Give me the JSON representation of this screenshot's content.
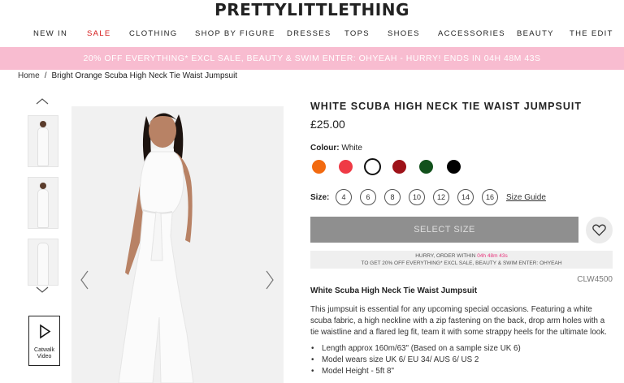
{
  "header": {
    "logo": "PRETTYLITTLETHING"
  },
  "nav": [
    "NEW IN",
    "SALE",
    "CLOTHING",
    "SHOP BY FIGURE",
    "DRESSES",
    "TOPS",
    "SHOES",
    "ACCESSORIES",
    "BEAUTY",
    "THE EDIT"
  ],
  "promo": {
    "text": "20% OFF EVERYTHING* EXCL SALE, BEAUTY & SWIM ENTER: OHYEAH - HURRY! ENDS IN 04H 48M 43S"
  },
  "breadcrumb": {
    "home": "Home",
    "separator": "/",
    "current": "Bright Orange Scuba High Neck Tie Waist Jumpsuit"
  },
  "gallery": {
    "catwalk_label_1": "Catwalk",
    "catwalk_label_2": "Video"
  },
  "product": {
    "title": "WHITE SCUBA HIGH NECK TIE WAIST JUMPSUIT",
    "price": "£25.00",
    "colour_label": "Colour:",
    "colour_value": "White",
    "swatches": [
      "#f26a10",
      "#ef3a45",
      "#ffffff",
      "#9e1219",
      "#12511c",
      "#000000"
    ],
    "size_label": "Size:",
    "sizes": [
      "4",
      "6",
      "8",
      "10",
      "12",
      "14",
      "16"
    ],
    "size_guide": "Size Guide",
    "select_size": "SELECT SIZE",
    "hurry_line1_a": "HURRY, ORDER WITHIN",
    "hurry_timer": "04h 48m 43s",
    "hurry_line2": "TO GET 20% OFF EVERYTHING* EXCL SALE, BEAUTY & SWIM ENTER: OHYEAH",
    "code": "CLW4500",
    "subtitle": "White Scuba High Neck Tie Waist Jumpsuit",
    "description": "This jumpsuit is essential for any upcoming special occasions. Featuring a white scuba fabric, a high neckline with a zip fastening on the back, drop arm holes with a tie waistline and a flared leg fit, team it with some strappy heels for the ultimate look.",
    "bullets": [
      "Length approx 160m/63\" (Based on a sample size UK 6)",
      "Model wears size UK 6/ EU 34/ AUS 6/ US 2",
      "Model Height - 5ft 8\""
    ]
  },
  "colors": {
    "promo_bg": "#f8bcd0",
    "sale": "#d51a1a",
    "timer": "#e8337b",
    "select_btn": "#8f8f8f"
  }
}
